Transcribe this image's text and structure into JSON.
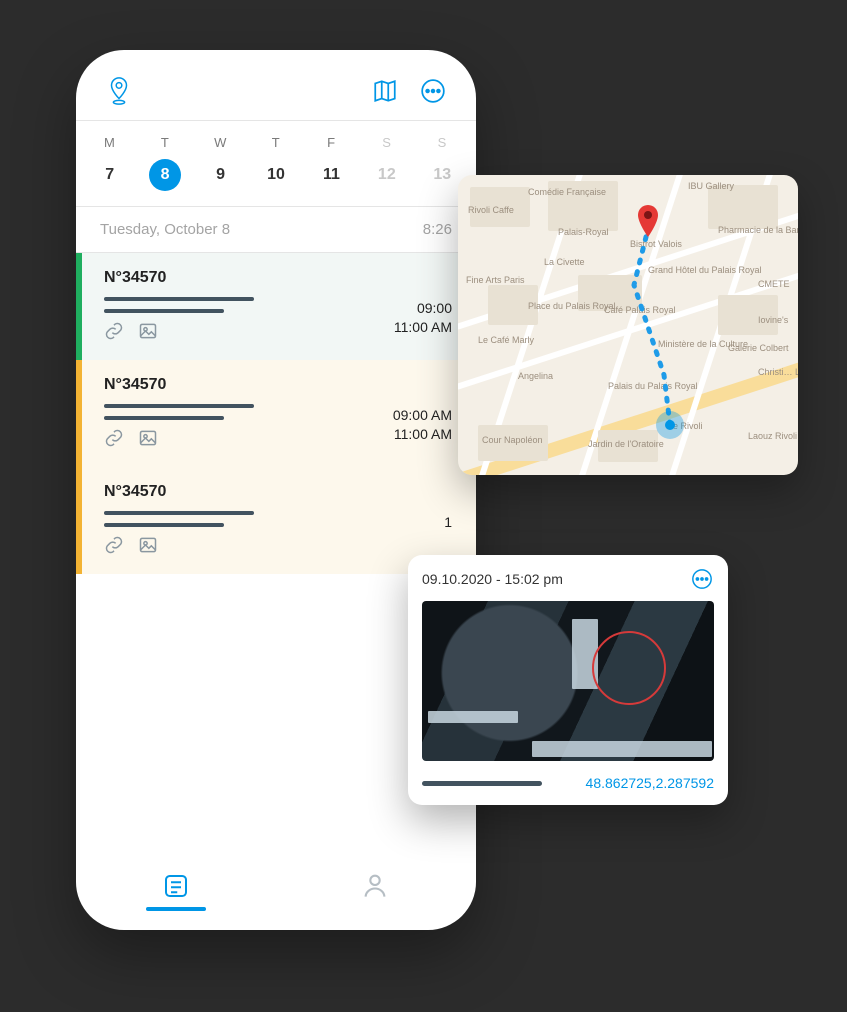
{
  "header": {},
  "calendar": {
    "days": [
      {
        "d": "M",
        "n": "7"
      },
      {
        "d": "T",
        "n": "8",
        "selected": true
      },
      {
        "d": "W",
        "n": "9"
      },
      {
        "d": "T",
        "n": "10"
      },
      {
        "d": "F",
        "n": "11"
      },
      {
        "d": "S",
        "n": "12",
        "weekend": true
      },
      {
        "d": "S",
        "n": "13",
        "weekend": true
      }
    ]
  },
  "datebar": {
    "date": "Tuesday, October 8",
    "time": "8:26"
  },
  "cards": [
    {
      "title": "N°34570",
      "time1": "09:00",
      "time2": "11:00 AM",
      "color": "grn"
    },
    {
      "title": "N°34570",
      "time1": "09:00 AM",
      "time2": "11:00 AM",
      "color": "yel"
    },
    {
      "title": "N°34570",
      "time1": "1",
      "time2": "",
      "color": "yel"
    }
  ],
  "map": {
    "labels": [
      "Rivoli Caffe",
      "Comédie Française",
      "IBU Gallery",
      "Palais-Royal",
      "Bistrot Valois",
      "La Civette",
      "Pharmacie de la Banque",
      "Fine Arts Paris",
      "Grand Hôtel du Palais Royal",
      "CMETE",
      "Place du Palais Royal",
      "Café Palais Royal",
      "Iovine's",
      "Le Café Marly",
      "Ministère de la Culture",
      "Galerie Colbert",
      "Angelina",
      "Christi… Loubou…",
      "Palais du Palais Royal",
      "Cour Napoléon",
      "Jardin de l'Oratoire",
      "Laouz Rivoli",
      "de Rivoli"
    ]
  },
  "photo": {
    "timestamp": "09.10.2020 - 15:02 pm",
    "coords": "48.862725,2.287592"
  }
}
